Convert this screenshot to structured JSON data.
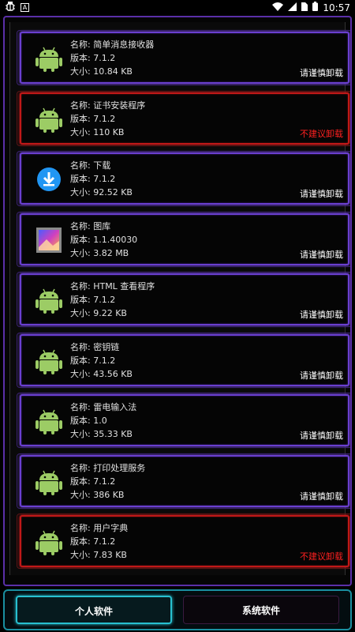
{
  "status_bar": {
    "time": "10:57",
    "icons": [
      "bug-icon",
      "a-badge-icon",
      "wifi-icon",
      "signal-icon",
      "sim-icon",
      "battery-icon"
    ]
  },
  "colors": {
    "safe_border": "#6a3fd0",
    "warn_border": "#c01818",
    "warn_text": "#ff2020",
    "tab_active": "#28c0d0"
  },
  "apps": [
    {
      "name": "名称: 简单消息接收器",
      "version": "版本: 7.1.2",
      "size": "大小: 10.84 KB",
      "action": "请谨慎卸载",
      "warn": false,
      "icon": "android-icon"
    },
    {
      "name": "名称: 证书安装程序",
      "version": "版本: 7.1.2",
      "size": "大小: 110 KB",
      "action": "不建议卸载",
      "warn": true,
      "icon": "android-icon"
    },
    {
      "name": "名称: 下载",
      "version": "版本: 7.1.2",
      "size": "大小: 92.52 KB",
      "action": "请谨慎卸载",
      "warn": false,
      "icon": "download-icon"
    },
    {
      "name": "名称: 图库",
      "version": "版本: 1.1.40030",
      "size": "大小: 3.82 MB",
      "action": "请谨慎卸载",
      "warn": false,
      "icon": "gallery-icon"
    },
    {
      "name": "名称: HTML 查看程序",
      "version": "版本: 7.1.2",
      "size": "大小: 9.22 KB",
      "action": "请谨慎卸载",
      "warn": false,
      "icon": "android-icon"
    },
    {
      "name": "名称: 密钥链",
      "version": "版本: 7.1.2",
      "size": "大小: 43.56 KB",
      "action": "请谨慎卸载",
      "warn": false,
      "icon": "android-icon"
    },
    {
      "name": "名称: 雷电输入法",
      "version": "版本: 1.0",
      "size": "大小: 35.33 KB",
      "action": "请谨慎卸载",
      "warn": false,
      "icon": "android-icon"
    },
    {
      "name": "名称: 打印处理服务",
      "version": "版本: 7.1.2",
      "size": "大小: 386 KB",
      "action": "请谨慎卸载",
      "warn": false,
      "icon": "android-icon"
    },
    {
      "name": "名称: 用户字典",
      "version": "版本: 7.1.2",
      "size": "大小: 7.83 KB",
      "action": "不建议卸载",
      "warn": true,
      "icon": "android-icon"
    }
  ],
  "tabs": {
    "personal": "个人软件",
    "system": "系统软件"
  }
}
